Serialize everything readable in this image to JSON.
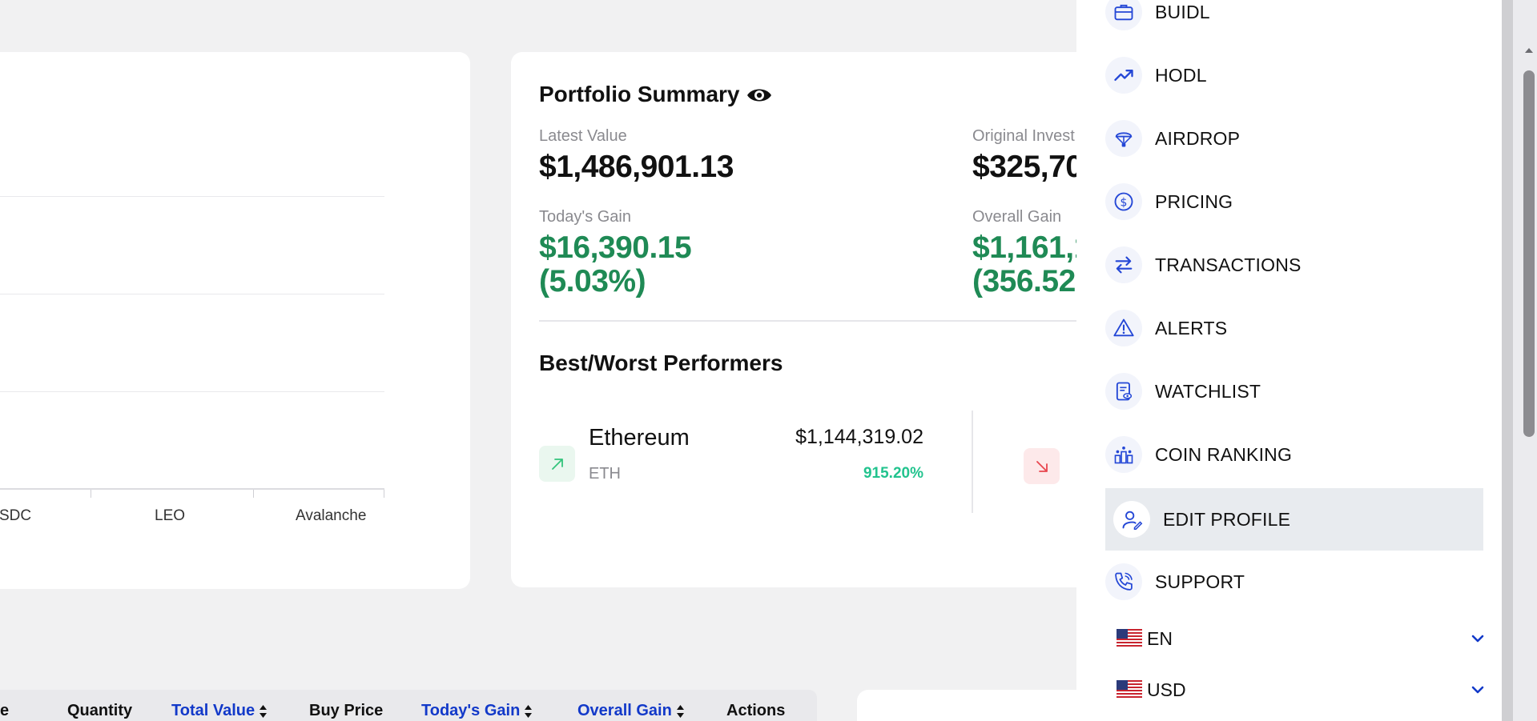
{
  "chart": {
    "x_labels": [
      "SDC",
      "LEO",
      "Avalanche"
    ]
  },
  "portfolio": {
    "title": "Portfolio Summary",
    "latest_value_label": "Latest Value",
    "latest_value": "$1,486,901.13",
    "original_investment_label": "Original Invest",
    "original_investment": "$325,70",
    "todays_gain_label": "Today's Gain",
    "todays_gain_amount": "$16,390.15",
    "todays_gain_pct": "(5.03%)",
    "overall_gain_label": "Overall Gain",
    "overall_gain_amount": "$1,161,19",
    "overall_gain_pct": "(356.52"
  },
  "performers": {
    "title": "Best/Worst Performers",
    "best": {
      "name": "Ethereum",
      "symbol": "ETH",
      "value": "$1,144,319.02",
      "pct": "915.20%"
    }
  },
  "table": {
    "headers": [
      {
        "label": "e",
        "sortable": false
      },
      {
        "label": "Quantity",
        "sortable": false
      },
      {
        "label": "Total Value",
        "sortable": true
      },
      {
        "label": "Buy Price",
        "sortable": false
      },
      {
        "label": "Today's Gain",
        "sortable": true
      },
      {
        "label": "Overall Gain",
        "sortable": true
      },
      {
        "label": "Actions",
        "sortable": false
      }
    ]
  },
  "menu": {
    "items": [
      {
        "label": "BUIDL",
        "icon": "briefcase-icon"
      },
      {
        "label": "HODL",
        "icon": "trending-up-icon"
      },
      {
        "label": "AIRDROP",
        "icon": "parachute-icon"
      },
      {
        "label": "PRICING",
        "icon": "dollar-circle-icon"
      },
      {
        "label": "TRANSACTIONS",
        "icon": "swap-arrows-icon"
      },
      {
        "label": "ALERTS",
        "icon": "warning-triangle-icon"
      },
      {
        "label": "WATCHLIST",
        "icon": "watchlist-eye-icon"
      },
      {
        "label": "COIN RANKING",
        "icon": "ranking-bars-icon"
      },
      {
        "label": "EDIT PROFILE",
        "icon": "user-edit-icon",
        "active": true
      },
      {
        "label": "SUPPORT",
        "icon": "phone-support-icon"
      }
    ],
    "language": "EN",
    "currency": "USD"
  },
  "colors": {
    "accent": "#1239c9",
    "gain_green": "#1f8a55",
    "pct_green": "#22c38e",
    "active_bg": "#e8ebef"
  }
}
